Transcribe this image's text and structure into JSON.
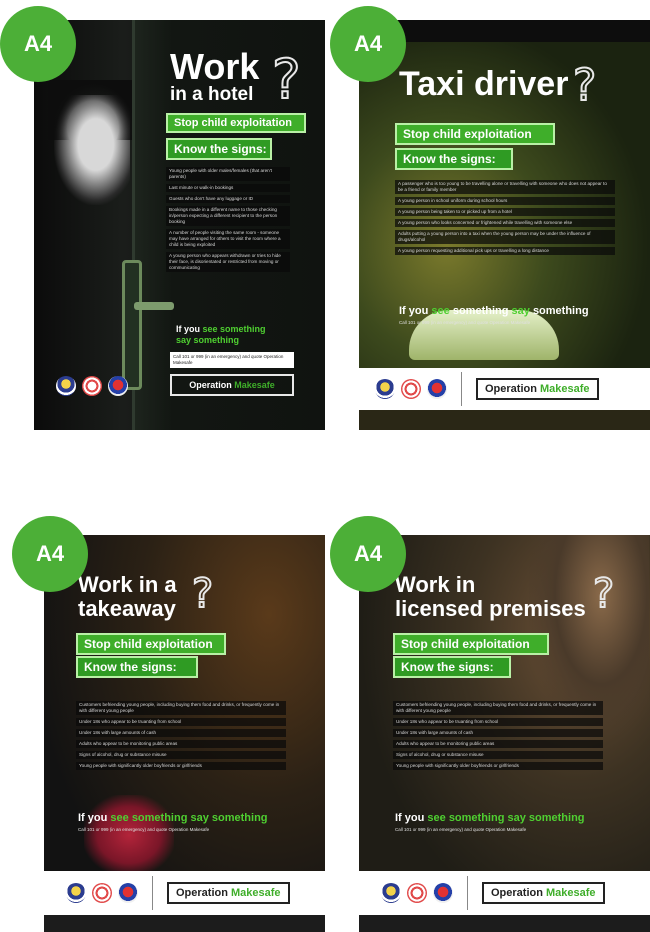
{
  "posters": [
    {
      "badge": "A4",
      "title_line1": "Work",
      "title_line2": "in a hotel",
      "stop_label": "Stop child exploitation",
      "signs_label": "Know the signs:",
      "signs": [
        "Young people with older males/females (that aren't parents)",
        "Last minute or walk-in bookings",
        "Guests who don't have any luggage or ID",
        "Bookings made in a different name to those checking in/person expecting a different recipient to the person booking",
        "A number of people visiting the same room - someone may have arranged for others to visit the room where a child is being exploited",
        "A young person who appears withdrawn or tries to hide their face, is disorientated or restricted from moving or communicating"
      ],
      "cta_prefix": "If you",
      "cta_see": "see something",
      "cta_say": "say something",
      "cta_sub": "Call 101 or 999 (in an emergency) and quote Operation Makesafe",
      "op_word1": "Operation",
      "op_word2": "Makesafe"
    },
    {
      "badge": "A4",
      "title_line1": "Taxi driver",
      "stop_label": "Stop child exploitation",
      "signs_label": "Know the signs:",
      "signs": [
        "A passenger who is too young to be travelling alone or travelling with someone who does not appear to be a friend or family member",
        "A young person in school uniform during school hours",
        "A young person being taken to or picked up from a hotel",
        "A young person who looks concerned or frightened while travelling with someone else",
        "Adults putting a young person into a taxi when the young person may be under the influence of drugs/alcohol",
        "A young person requesting additional pick ups or travelling a long distance"
      ],
      "cta_prefix": "If you",
      "cta_see": "see",
      "cta_mid": "something",
      "cta_say": "say",
      "cta_end": "something",
      "cta_sub": "Call 101 or 999 (in an emergency) and quote Operation Makesafe",
      "op_word1": "Operation",
      "op_word2": "Makesafe"
    },
    {
      "badge": "A4",
      "title_line1": "Work in a",
      "title_line2": "takeaway",
      "stop_label": "Stop child exploitation",
      "signs_label": "Know the signs:",
      "signs": [
        "Customers befriending young people, including buying them food and drinks, or frequently come in with different young people",
        "Under 18s who appear to be truanting from school",
        "Under 18s with large amounts of cash",
        "Adults who appear to be monitoring public areas",
        "Signs of alcohol, drug or substance misuse",
        "Young people with significantly older boyfriends or girlfriends"
      ],
      "cta_prefix": "If you",
      "cta_see": "see something",
      "cta_say": "say something",
      "cta_sub": "Call 101 or 999 (in an emergency) and quote Operation Makesafe",
      "op_word1": "Operation",
      "op_word2": "Makesafe"
    },
    {
      "badge": "A4",
      "title_line1": "Work in",
      "title_line2": "licensed premises",
      "stop_label": "Stop child exploitation",
      "signs_label": "Know the signs:",
      "signs": [
        "Customers befriending young people, including buying them food and drinks, or frequently come in with different young people",
        "Under 18s who appear to be truanting from school",
        "Under 18s with large amounts of cash",
        "Adults who appear to be monitoring public areas",
        "Signs of alcohol, drug or substance misuse",
        "Young people with significantly older boyfriends or girlfriends"
      ],
      "cta_prefix": "If you",
      "cta_see": "see something",
      "cta_say": "say something",
      "cta_sub": "Call 101 or 999 (in an emergency) and quote Operation Makesafe",
      "op_word1": "Operation",
      "op_word2": "Makesafe"
    }
  ],
  "colors": {
    "badge": "#4caf37",
    "accent": "#3fae2a"
  }
}
